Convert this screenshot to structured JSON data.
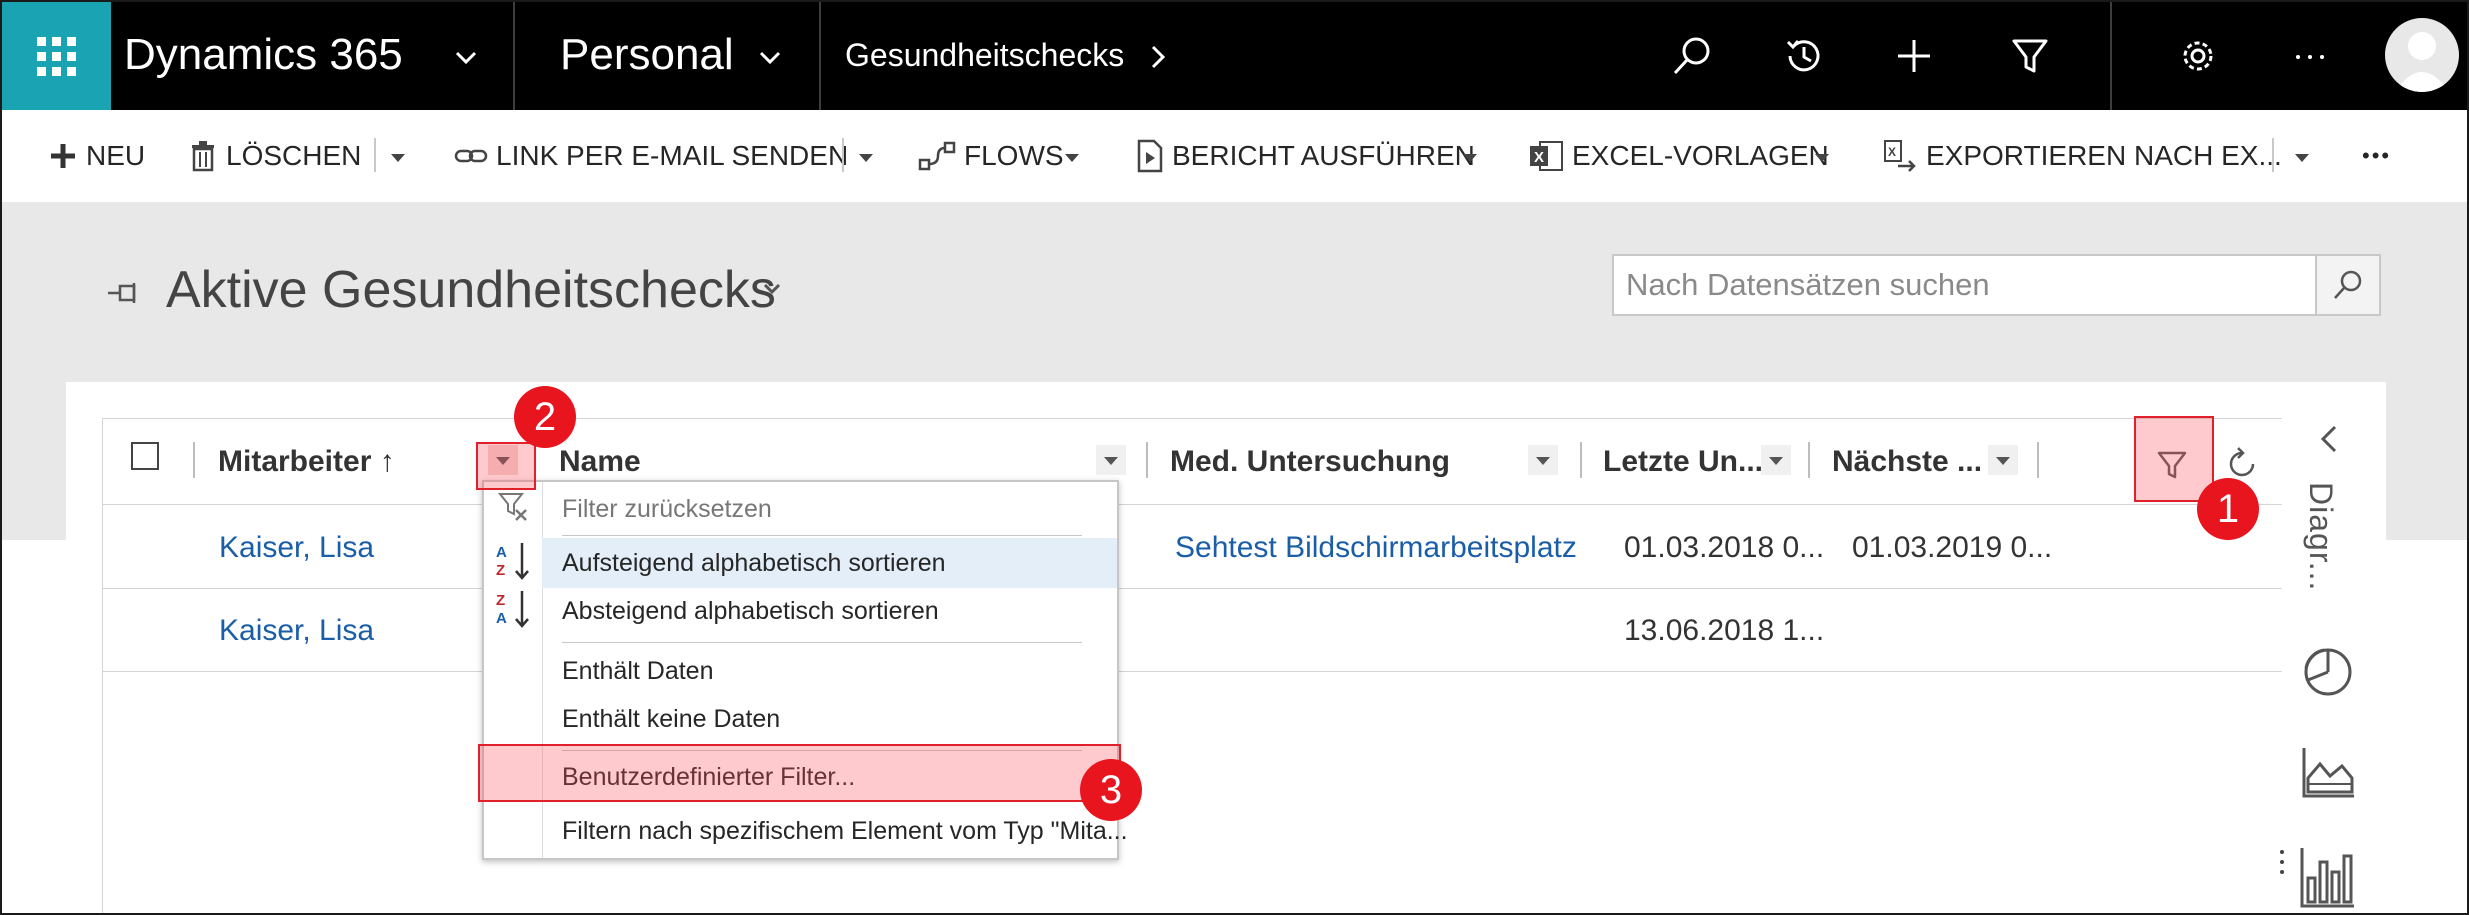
{
  "topbar": {
    "app_name": "Dynamics 365",
    "area_name": "Personal",
    "entity_name": "Gesundheitschecks",
    "icons": [
      "waffle-icon",
      "chevron-down-icon",
      "search-icon",
      "history-icon",
      "plus-icon",
      "filter-icon",
      "gear-icon",
      "more-icon",
      "avatar-icon"
    ]
  },
  "commands": {
    "new": "NEU",
    "delete": "LÖSCHEN",
    "email_link": "LINK PER E-MAIL SENDEN",
    "flows": "FLOWS",
    "run_report": "BERICHT AUSFÜHREN",
    "excel_templates": "EXCEL-VORLAGEN",
    "export": "EXPORTIEREN NACH EX...",
    "more": "•••"
  },
  "view": {
    "title": "Aktive Gesundheitschecks",
    "search_placeholder": "Nach Datensätzen suchen"
  },
  "grid": {
    "columns": [
      {
        "label": "Mitarbeiter ↑"
      },
      {
        "label": "Name"
      },
      {
        "label": "Med. Untersuchung"
      },
      {
        "label": "Letzte Un..."
      },
      {
        "label": "Nächste ..."
      }
    ],
    "rows": [
      {
        "mitarbeiter": "Kaiser, Lisa",
        "untersuchung": "Sehtest Bildschirmarbeitsplatz",
        "letzte": "01.03.2018 0...",
        "naechste": "01.03.2019 0..."
      },
      {
        "mitarbeiter": "Kaiser, Lisa",
        "untersuchung": "",
        "letzte": "13.06.2018 1...",
        "naechste": ""
      }
    ]
  },
  "sidebar": {
    "label": "Diagr..."
  },
  "menu": {
    "items": [
      "Filter zurücksetzen",
      "Aufsteigend alphabetisch sortieren",
      "Absteigend alphabetisch sortieren",
      "Enthält Daten",
      "Enthält keine Daten",
      "Benutzerdefinierter Filter...",
      "Filtern nach spezifischem Element vom Typ \"Mita..."
    ]
  },
  "annotations": {
    "badge_1": "1",
    "badge_2": "2",
    "badge_3": "3",
    "highlight_color": "#e0202a"
  },
  "colors": {
    "topbar_bg": "#000000",
    "waffle_bg": "#1aa3b3",
    "link": "#1a5ea8",
    "badge": "#e8141e"
  }
}
